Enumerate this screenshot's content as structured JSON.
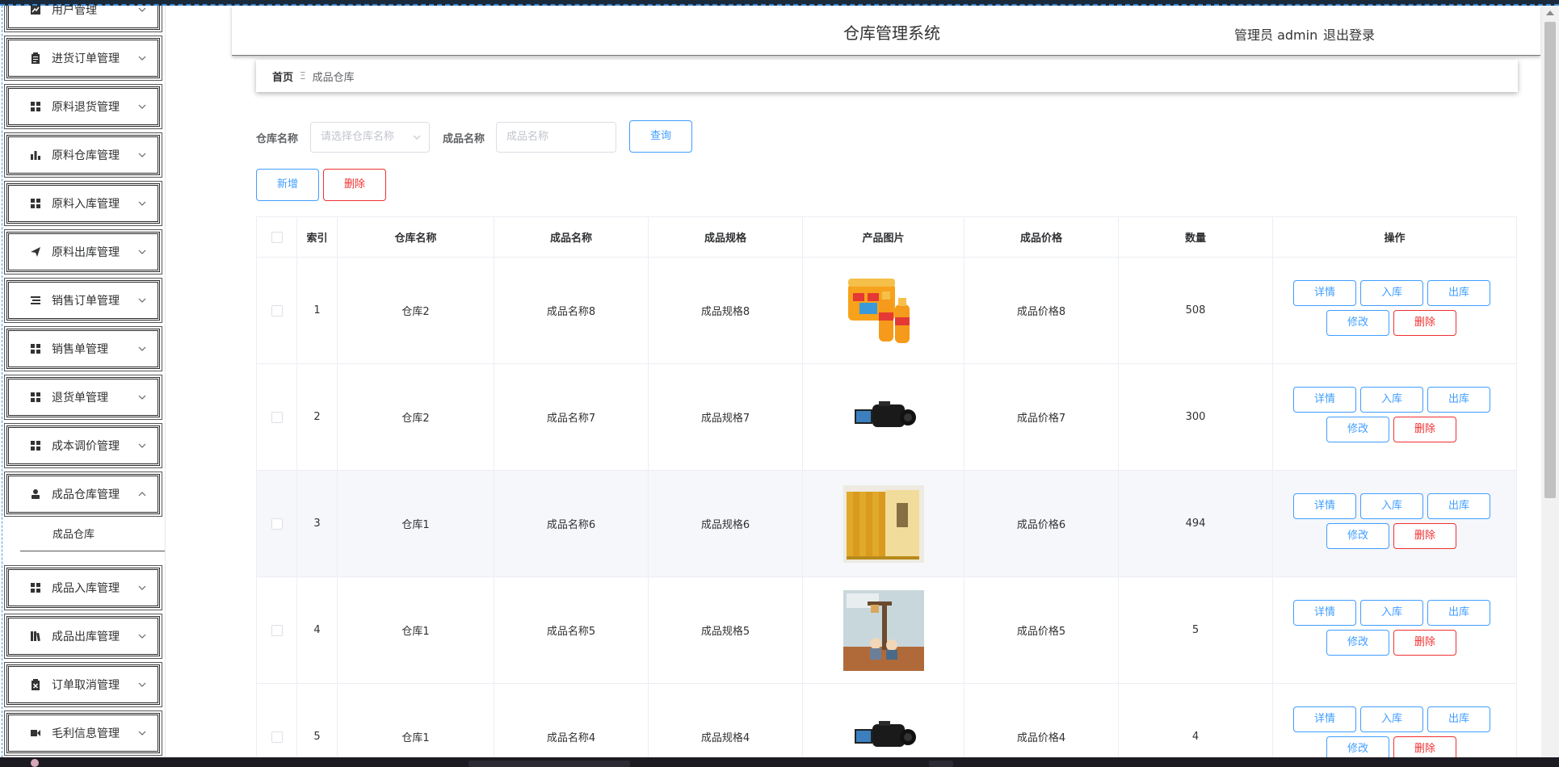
{
  "header": {
    "title": "仓库管理系统",
    "user_label": "管理员 admin",
    "logout_label": "退出登录"
  },
  "sidebar": {
    "items": [
      {
        "label": "用户管理",
        "icon": "chart-icon"
      },
      {
        "label": "进货订单管理",
        "icon": "clipboard-icon"
      },
      {
        "label": "原料退货管理",
        "icon": "grid-icon"
      },
      {
        "label": "原料仓库管理",
        "icon": "bar-chart-icon"
      },
      {
        "label": "原料入库管理",
        "icon": "grid-icon"
      },
      {
        "label": "原料出库管理",
        "icon": "send-icon"
      },
      {
        "label": "销售订单管理",
        "icon": "list-icon"
      },
      {
        "label": "销售单管理",
        "icon": "grid-icon"
      },
      {
        "label": "退货单管理",
        "icon": "grid-icon"
      },
      {
        "label": "成本调价管理",
        "icon": "grid-icon"
      },
      {
        "label": "成品仓库管理",
        "icon": "user-icon"
      },
      {
        "label": "成品入库管理",
        "icon": "grid-icon"
      },
      {
        "label": "成品出库管理",
        "icon": "books-icon"
      },
      {
        "label": "订单取消管理",
        "icon": "cancel-clipboard-icon"
      },
      {
        "label": "毛利信息管理",
        "icon": "video-icon"
      }
    ],
    "submenu": {
      "label": "成品仓库"
    }
  },
  "breadcrumb": {
    "home": "首页",
    "separator": "Ξ",
    "current": "成品仓库"
  },
  "search": {
    "warehouse_label": "仓库名称",
    "warehouse_placeholder": "请选择仓库名称",
    "product_label": "成品名称",
    "product_placeholder": "成品名称",
    "query_button": "查询"
  },
  "actions": {
    "add_button": "新增",
    "delete_button": "删除"
  },
  "table": {
    "columns": [
      "索引",
      "仓库名称",
      "成品名称",
      "成品规格",
      "产品图片",
      "成品价格",
      "数量",
      "操作"
    ],
    "row_buttons": {
      "detail": "详情",
      "in": "入库",
      "out": "出库",
      "edit": "修改",
      "delete": "删除"
    },
    "rows": [
      {
        "index": "1",
        "warehouse": "仓库2",
        "name": "成品名称8",
        "spec": "成品规格8",
        "image": "orange-juice",
        "price": "成品价格8",
        "qty": "508"
      },
      {
        "index": "2",
        "warehouse": "仓库2",
        "name": "成品名称7",
        "spec": "成品规格7",
        "image": "camcorder",
        "price": "成品价格7",
        "qty": "300"
      },
      {
        "index": "3",
        "warehouse": "仓库1",
        "name": "成品名称6",
        "spec": "成品规格6",
        "image": "books",
        "price": "成品价格6",
        "qty": "494"
      },
      {
        "index": "4",
        "warehouse": "仓库1",
        "name": "成品名称5",
        "spec": "成品规格5",
        "image": "figurine-lamp",
        "price": "成品价格5",
        "qty": "5"
      },
      {
        "index": "5",
        "warehouse": "仓库1",
        "name": "成品名称4",
        "spec": "成品规格4",
        "image": "camcorder",
        "price": "成品价格4",
        "qty": "4"
      }
    ]
  },
  "colors": {
    "primary": "#409eff",
    "danger": "#f03030",
    "highlight_row": "#f5f7fa"
  }
}
